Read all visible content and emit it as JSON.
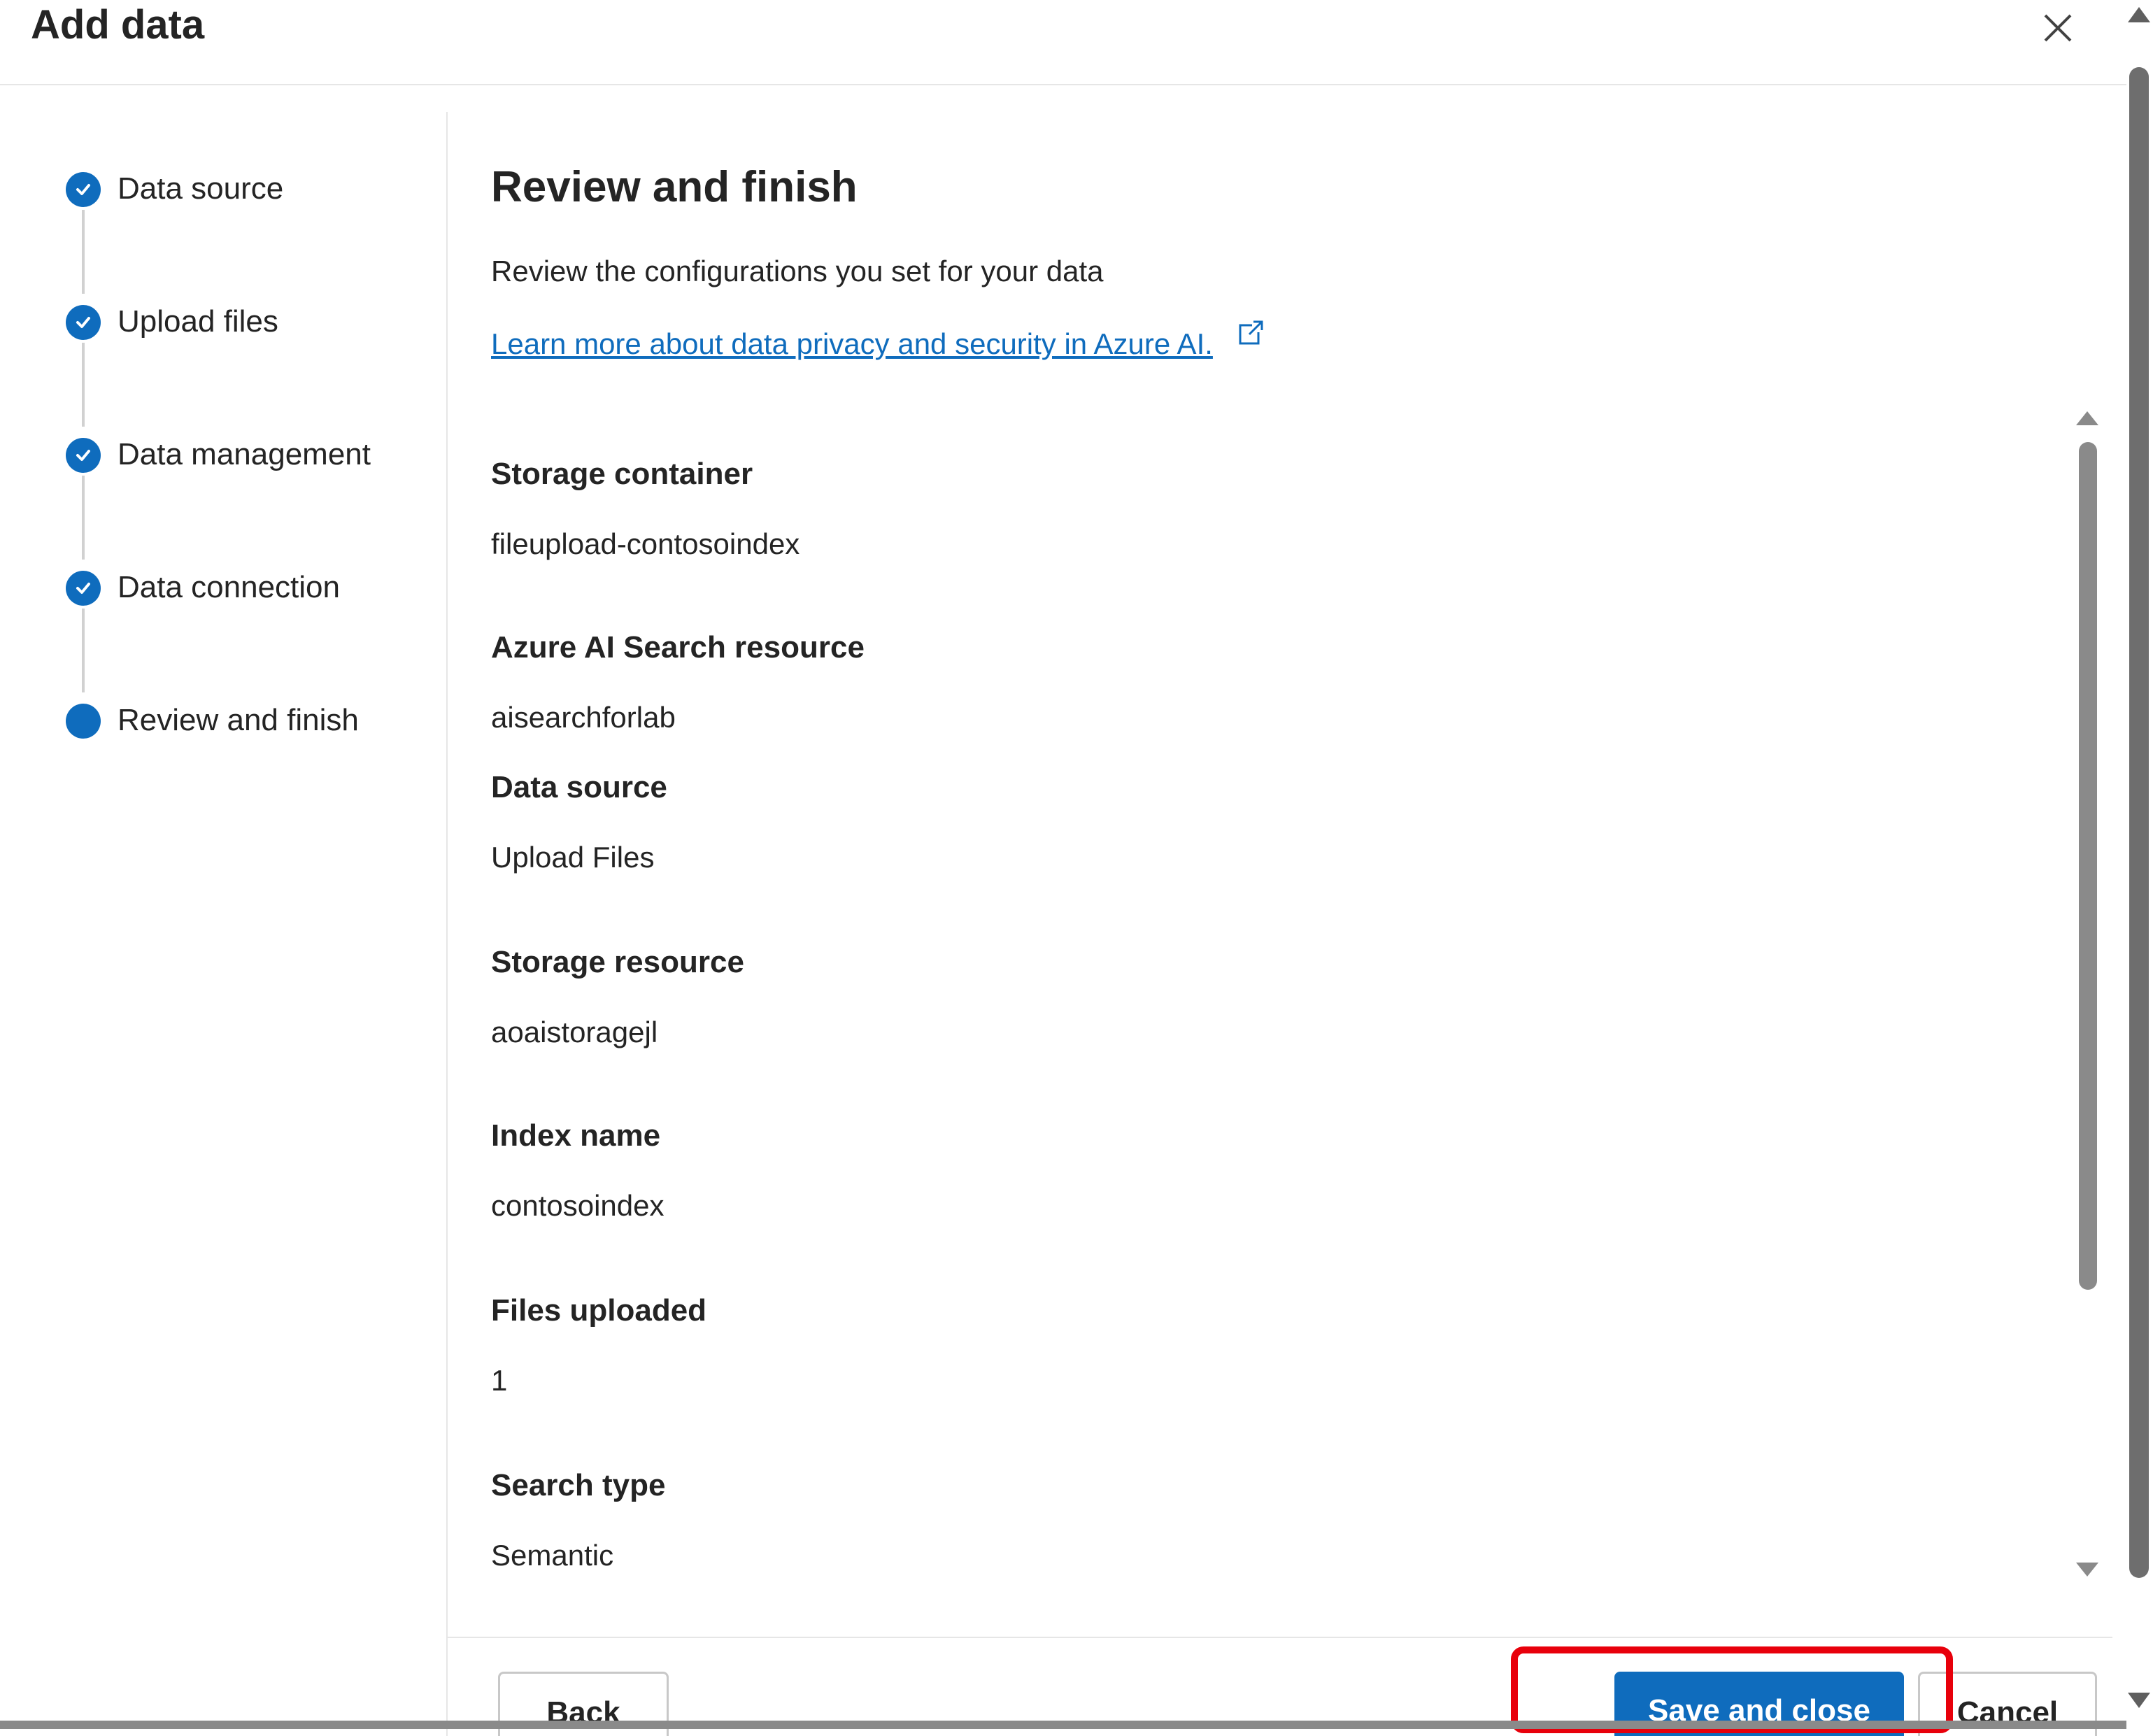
{
  "dialog": {
    "title": "Add data",
    "close_icon": "close-icon"
  },
  "steps": [
    {
      "label": "Data source",
      "status": "completed",
      "icon": "check-icon"
    },
    {
      "label": "Upload files",
      "status": "completed",
      "icon": "check-icon"
    },
    {
      "label": "Data management",
      "status": "completed",
      "icon": "check-icon"
    },
    {
      "label": "Data connection",
      "status": "completed",
      "icon": "check-icon"
    },
    {
      "label": "Review and finish",
      "status": "current",
      "icon": "current-step-dot"
    }
  ],
  "main": {
    "heading": "Review and finish",
    "description": "Review the configurations you set for your data",
    "learn_link": "Learn more about data privacy and security in Azure AI.",
    "learn_link_icon": "external-link-icon",
    "fields": [
      {
        "label": "Storage container",
        "value": "fileupload-contosoindex"
      },
      {
        "label": "Azure AI Search resource",
        "value": "aisearchforlab"
      },
      {
        "label": "Data source",
        "value": "Upload Files"
      },
      {
        "label": "Storage resource",
        "value": "aoaistoragejl"
      },
      {
        "label": "Index name",
        "value": "contosoindex"
      },
      {
        "label": "Files uploaded",
        "value": "1"
      },
      {
        "label": "Search type",
        "value": "Semantic"
      }
    ]
  },
  "footer": {
    "back_label": "Back",
    "save_label": "Save and close",
    "cancel_label": "Cancel"
  },
  "colors": {
    "accent": "#0f6cbd",
    "highlight": "#e8000b"
  }
}
